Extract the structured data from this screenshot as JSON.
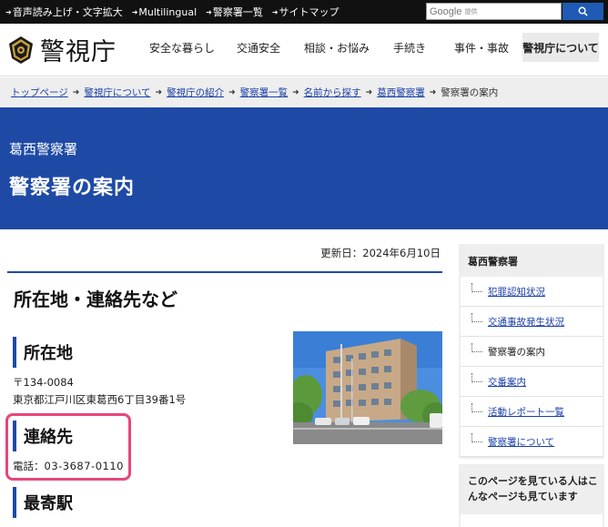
{
  "utility_bar": {
    "links": [
      "音声読み上げ・文字拡大",
      "Multilingual",
      "警察署一覧",
      "サイトマップ"
    ],
    "search_brand": "Google",
    "search_provided": "提供"
  },
  "header": {
    "logo_text": "警視庁",
    "nav": [
      "安全な暮らし",
      "交通安全",
      "相談・お悩み",
      "手続き",
      "事件・事故",
      "警視庁について"
    ]
  },
  "breadcrumb": {
    "links": [
      "トップページ",
      "警視庁について",
      "警視庁の紹介",
      "警察署一覧",
      "名前から探す",
      "葛西警察署"
    ],
    "current": "警察署の案内"
  },
  "banner": {
    "subtitle": "葛西警察署",
    "title": "警察署の案内"
  },
  "main": {
    "updated": "更新日：2024年6月10日",
    "heading": "所在地・連絡先など",
    "location_heading": "所在地",
    "postal": "〒134-0084",
    "address": "東京都江戸川区東葛西6丁目39番1号",
    "contact_heading": "連絡先",
    "tel_label": "電話：",
    "tel_number": "03-3687-0110",
    "station_heading": "最寄駅"
  },
  "side_nav": {
    "title": "葛西警察署",
    "items": [
      "犯罪認知状況",
      "交通事故発生状況",
      "警察署の案内",
      "交番案内",
      "活動レポート一覧",
      "警察署について"
    ]
  },
  "side_related": {
    "title": "このページを見ている人はこんなページも見ています"
  },
  "colors": {
    "brand_blue": "#1e4aa6",
    "link_blue": "#1a3fa8",
    "highlight_pink": "#e8457a",
    "top_bar": "#111111"
  },
  "icons": [
    "police-emblem-icon",
    "search-icon",
    "arrow-icon"
  ]
}
